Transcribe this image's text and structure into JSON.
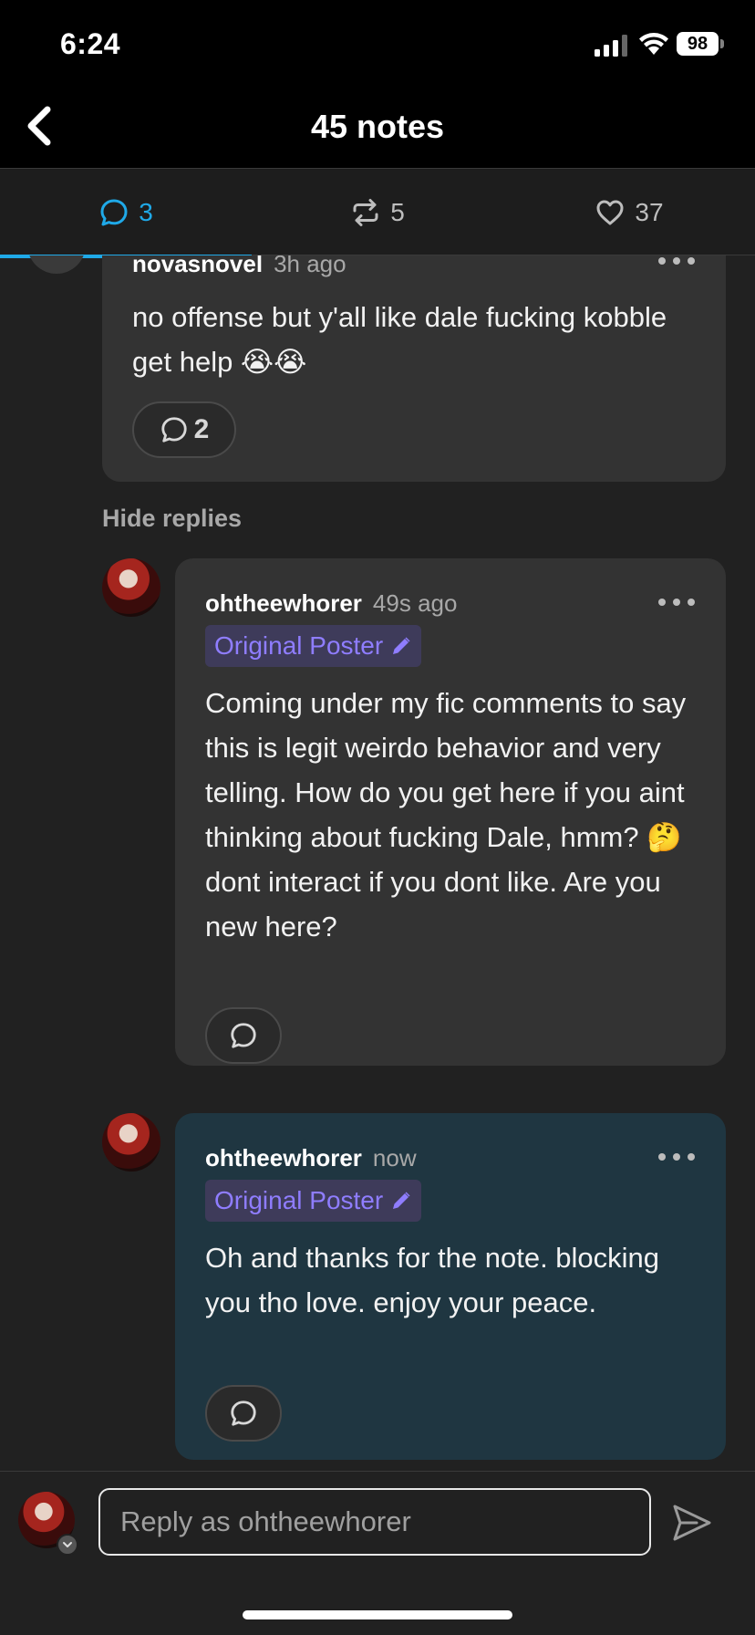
{
  "status_bar": {
    "time": "6:24",
    "battery": "98"
  },
  "header": {
    "title": "45 notes"
  },
  "tabs": [
    {
      "label": "3",
      "icon": "comment-icon",
      "active": true
    },
    {
      "label": "5",
      "icon": "reblog-icon",
      "active": false
    },
    {
      "label": "37",
      "icon": "heart-icon",
      "active": false
    }
  ],
  "comments": {
    "parent": {
      "username": "novasnovel",
      "time": "3h ago",
      "text": "no offense but y'all like dale fucking kobble get help 😭😭",
      "reply_count": "2"
    },
    "hide_replies": "Hide replies",
    "replies": [
      {
        "username": "ohtheewhorer",
        "time": "49s ago",
        "badge": "Original Poster",
        "text": "Coming under my fic comments to say this is legit weirdo behavior and very telling. How do you get here if you aint thinking about fucking Dale, hmm? 🤔 dont interact if you dont like. Are you new here?"
      },
      {
        "username": "ohtheewhorer",
        "time": "now",
        "badge": "Original Poster",
        "text": "Oh and thanks for the note. blocking you tho love. enjoy your peace."
      }
    ]
  },
  "composer": {
    "placeholder": "Reply as ohtheewhorer"
  },
  "colors": {
    "accent": "#1fa9e8",
    "op_badge": "#8f7dff",
    "highlight_card": "#1f3641"
  }
}
